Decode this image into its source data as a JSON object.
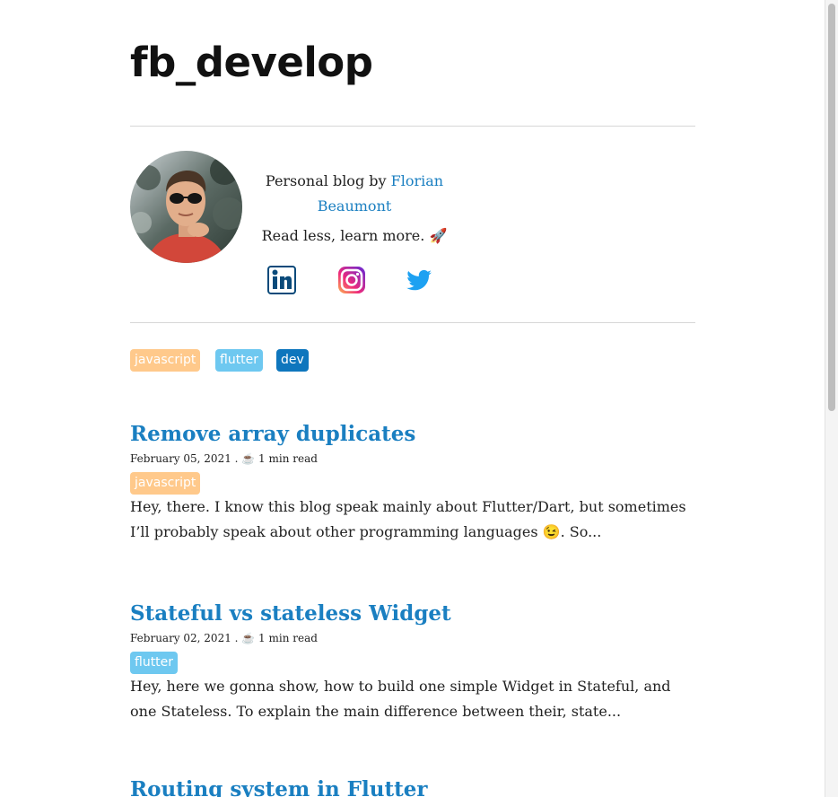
{
  "site": {
    "title": "fb_develop"
  },
  "bio": {
    "prefix": "Personal blog by ",
    "author": "Florian Beaumont",
    "tagline": "Read less, learn more. 🚀"
  },
  "social": [
    {
      "name": "linkedin-icon"
    },
    {
      "name": "instagram-icon"
    },
    {
      "name": "twitter-icon"
    }
  ],
  "tags": [
    {
      "label": "javascript",
      "color": "#ffc98b"
    },
    {
      "label": "flutter",
      "color": "#6ec8f0"
    },
    {
      "label": "dev",
      "color": "#0e76bd"
    }
  ],
  "posts": [
    {
      "title": "Remove array duplicates",
      "date": "February 05, 2021",
      "read": "☕ 1 min read",
      "tag": "javascript",
      "excerpt": "Hey, there. I know this blog speak mainly about Flutter/Dart, but sometimes I’ll probably speak about other programming languages 😉. So..."
    },
    {
      "title": "Stateful vs stateless Widget",
      "date": "February 02, 2021",
      "read": "☕ 1 min read",
      "tag": "flutter",
      "excerpt": "Hey, here we gonna show, how to build one simple Widget in Stateful, and one Stateless. To explain the main difference between their, state..."
    },
    {
      "title": "Routing system in Flutter"
    }
  ],
  "colors": {
    "link": "#1a7fc1",
    "tag_javascript": "#ffc98b",
    "tag_flutter": "#6ec8f0",
    "tag_dev": "#0e76bd"
  }
}
